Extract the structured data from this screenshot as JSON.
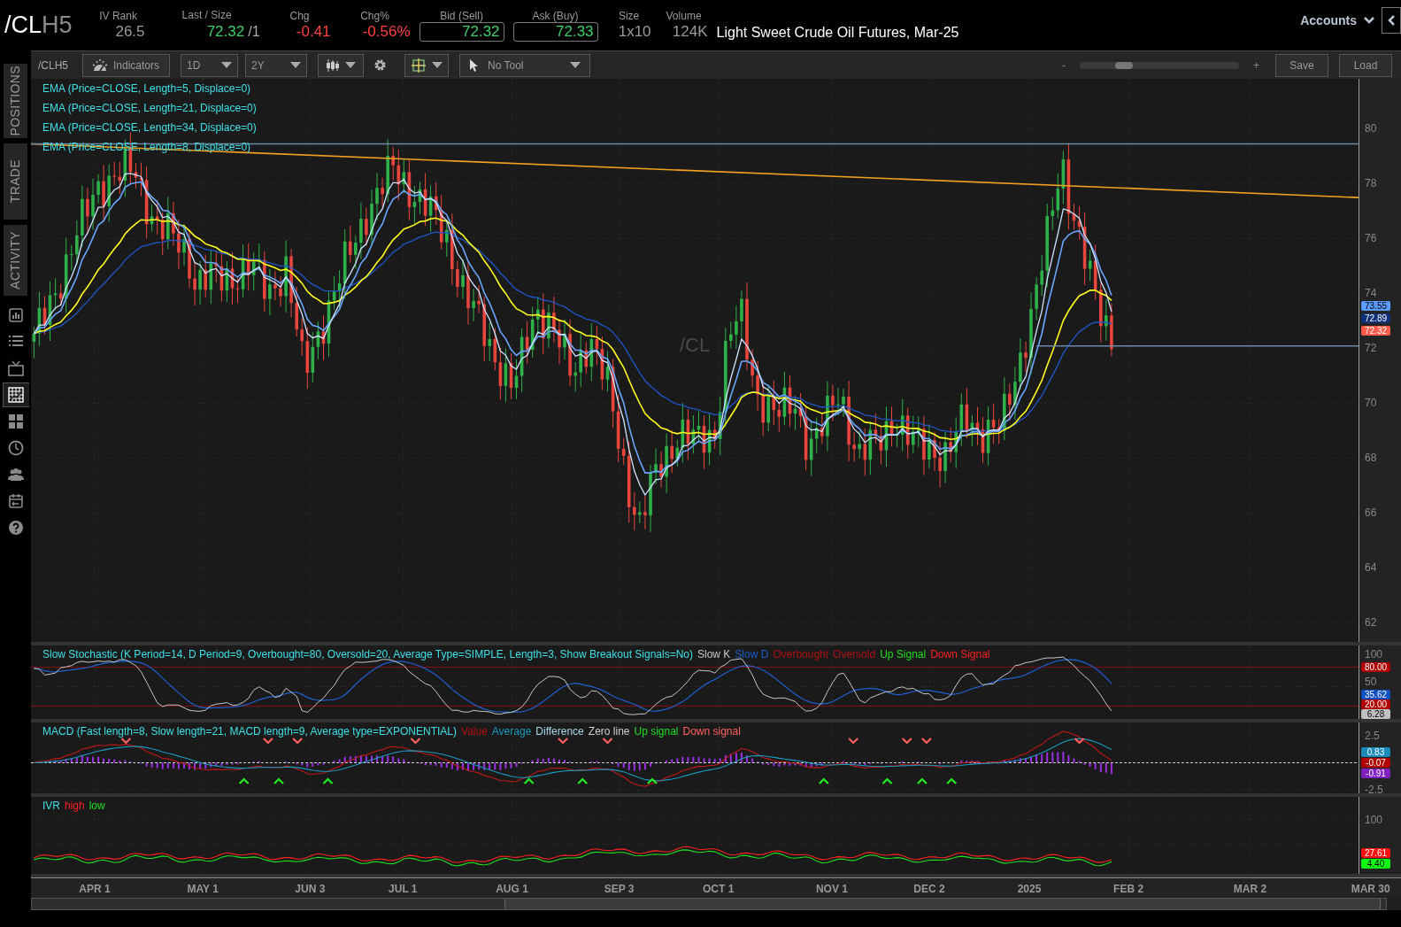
{
  "header": {
    "symbol": "/CL",
    "symbol_suffix": "H5",
    "quote": [
      {
        "label": "IV Rank",
        "value": "26.5",
        "color": "#9a9a9a",
        "boxed": false
      },
      {
        "label": "Last / Size",
        "value": "72.32",
        "suffix": "/1",
        "color": "#3ecf6a",
        "boxed": false
      },
      {
        "label": "Chg",
        "value": "-0.41",
        "color": "#ff4040",
        "boxed": false
      },
      {
        "label": "Chg%",
        "value": "-0.56%",
        "color": "#ff4040",
        "boxed": false
      },
      {
        "label": "Bid (Sell)",
        "value": "72.32",
        "color": "#3ecf6a",
        "boxed": true
      },
      {
        "label": "Ask (Buy)",
        "value": "72.33",
        "color": "#3ecf6a",
        "boxed": true
      },
      {
        "label": "Size",
        "value": "1x10",
        "color": "#9a9a9a",
        "boxed": false
      },
      {
        "label": "Volume",
        "value": "124K",
        "color": "#9a9a9a",
        "boxed": false
      }
    ],
    "description": "Light Sweet Crude Oil Futures, Mar-25",
    "accounts": "Accounts"
  },
  "sidebar": {
    "tabs": [
      "POSITIONS",
      "TRADE",
      "ACTIVITY"
    ],
    "icons": [
      {
        "selected": false
      },
      {
        "selected": false
      },
      {
        "selected": false
      },
      {
        "selected": true
      },
      {
        "selected": false
      },
      {
        "selected": false
      },
      {
        "selected": false
      },
      {
        "selected": false
      },
      {
        "selected": false
      }
    ]
  },
  "toolbar": {
    "symbol": "/CLH5",
    "indicators": "Indicators",
    "aggregation": "1D",
    "range": "2Y",
    "tool": "No Tool",
    "zoom_minus": "-",
    "zoom_plus": "+",
    "zoom_slider": {
      "level": 0.25
    },
    "save": "Save",
    "load": "Load"
  },
  "price_chart": {
    "studies": [
      "EMA (Price=CLOSE, Length=5, Displace=0)",
      "EMA (Price=CLOSE, Length=21, Displace=0)",
      "EMA (Price=CLOSE, Length=34, Displace=0)",
      "EMA (Price=CLOSE, Length=8, Displace=0)"
    ],
    "watermark": "/CL",
    "y_ticks": [
      "80",
      "78",
      "76",
      "74",
      "72",
      "70",
      "68",
      "66",
      "64",
      "62"
    ],
    "badges": [
      {
        "value": "73.55",
        "color": "#5a9cff"
      },
      {
        "value": "72.89",
        "color": "#10307a"
      },
      {
        "value": "72.32",
        "color": "#ff5a4a"
      }
    ]
  },
  "stochastic": {
    "title": "Slow Stochastic (K Period=14, D Period=9, Overbought=80, Oversold=20, Average Type=SIMPLE, Length=3, Show Breakout Signals=No)",
    "legend": [
      {
        "text": "Slow K",
        "color": "#c8c8c8"
      },
      {
        "text": "Slow D",
        "color": "#1f5fd0"
      },
      {
        "text": "Overbought",
        "color": "#b01010"
      },
      {
        "text": "Oversold",
        "color": "#b01010"
      },
      {
        "text": "Up Signal",
        "color": "#22dd22"
      },
      {
        "text": "Down Signal",
        "color": "#ff2020"
      }
    ],
    "y_ticks": [
      "100",
      "50"
    ],
    "badges": [
      {
        "value": "80.00",
        "color": "#b00000"
      },
      {
        "value": "35.62",
        "color": "#1050c0"
      },
      {
        "value": "20.00",
        "color": "#b00000"
      },
      {
        "value": "6.28",
        "color": "#c0c0c0"
      }
    ]
  },
  "macd": {
    "title": "MACD (Fast length=8, Slow length=21, MACD length=9, Average type=EXPONENTIAL)",
    "legend": [
      {
        "text": "Value",
        "color": "#b01010"
      },
      {
        "text": "Average",
        "color": "#1a9ac0"
      },
      {
        "text": "Difference",
        "color": "#a8d8e8"
      },
      {
        "text": "Zero line",
        "color": "#d0d0d0"
      },
      {
        "text": "Up signal",
        "color": "#22dd22"
      },
      {
        "text": "Down signal",
        "color": "#ff6060"
      }
    ],
    "y_ticks": [
      "2.5",
      "-2.5"
    ],
    "badges": [
      {
        "value": "0.83",
        "color": "#1a8ab8"
      },
      {
        "value": "-0.07",
        "color": "#b00000"
      },
      {
        "value": "-0.91",
        "color": "#8020c0"
      }
    ]
  },
  "ivr": {
    "title": "IVR",
    "legend": [
      {
        "text": "high",
        "color": "#ff2020"
      },
      {
        "text": "low",
        "color": "#20e020"
      }
    ],
    "y_ticks": [
      "100"
    ],
    "badges": [
      {
        "value": "27.61",
        "color": "#ff1010"
      },
      {
        "value": "4.40",
        "color": "#10ff10"
      }
    ]
  },
  "x_axis": {
    "labels": [
      "APR 1",
      "MAY 1",
      "JUN 3",
      "JUL 1",
      "AUG 1",
      "SEP 3",
      "OCT 1",
      "NOV 1",
      "DEC 2",
      "2025",
      "FEB 2",
      "MAR 2",
      "MAR 30"
    ]
  }
}
